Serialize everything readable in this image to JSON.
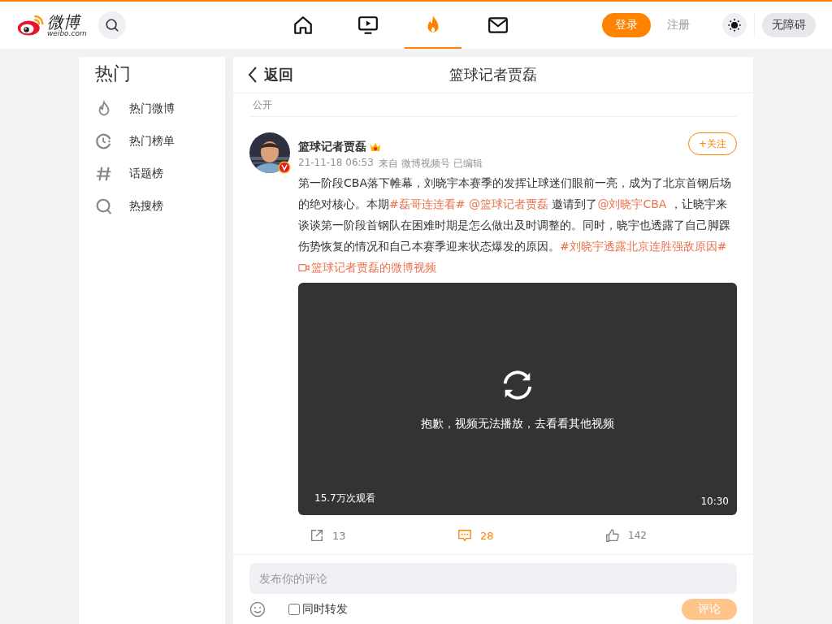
{
  "header": {
    "logo_text": "微博",
    "logo_sub": "weibo.com",
    "nav": [
      {
        "kind": "home",
        "selected": false
      },
      {
        "kind": "video",
        "selected": false
      },
      {
        "kind": "hot",
        "selected": true
      },
      {
        "kind": "mail",
        "selected": false
      }
    ],
    "login": "登录",
    "register": "注册",
    "accessibility": "无障碍"
  },
  "sidebar": {
    "title": "热门",
    "items": [
      {
        "kind": "flame",
        "label": "热门微博"
      },
      {
        "kind": "clock",
        "label": "热门榜单"
      },
      {
        "kind": "hash",
        "label": "话题榜"
      },
      {
        "kind": "search",
        "label": "热搜榜"
      }
    ]
  },
  "page_header": {
    "back": "返回",
    "title": "篮球记者贾磊"
  },
  "visibility": "公开",
  "post": {
    "author": "篮球记者贾磊",
    "time": "21-11-18 06:53",
    "source": "来自 微博视频号 已编辑",
    "follow": "+关注",
    "body": [
      {
        "kind": "text",
        "text": "第一阶段CBA落下帷幕，刘晓宇本赛季的发挥让球迷们眼前一亮，成为了北京首钢后场的绝对核心。本期"
      },
      {
        "kind": "link",
        "text": "#磊哥连连看#"
      },
      {
        "kind": "link",
        "text": " @篮球记者贾磊"
      },
      {
        "kind": "text",
        "text": " 邀请到了"
      },
      {
        "kind": "link",
        "text": "@刘晓宇CBA"
      },
      {
        "kind": "text",
        "text": " ，让晓宇来谈谈第一阶段首钢队在困难时期是怎么做出及时调整的。同时，晓宇也透露了自己脚踝伤势恢复的情况和自己本赛季迎来状态爆发的原因。"
      },
      {
        "kind": "link",
        "text": "#刘晓宇透露北京连胜强敌原因#"
      }
    ],
    "video_link": "篮球记者贾磊的微博视频",
    "video": {
      "message": "抱歉，视频无法播放，去看看其他视频",
      "views": "15.7万次观看",
      "duration": "10:30"
    },
    "actions": [
      {
        "kind": "repost",
        "count": "13",
        "selected": false
      },
      {
        "kind": "comment",
        "count": "28",
        "selected": true
      },
      {
        "kind": "like",
        "count": "142",
        "selected": false
      }
    ]
  },
  "comment_box": {
    "placeholder": "发布你的评论",
    "repost_label": "同时转发",
    "repost_checked": false,
    "submit": "评论"
  }
}
